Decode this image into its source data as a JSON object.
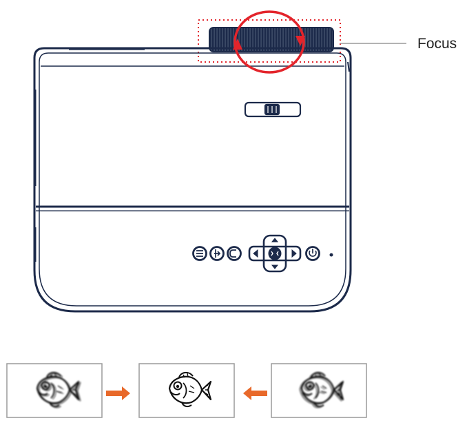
{
  "labels": {
    "focus": "Focus"
  },
  "colors": {
    "outline": "#1c2a4a",
    "focus_ring": "#e3242b",
    "arrow": "#e8692a",
    "frame_border": "#9a9a9a",
    "leader_line": "#9a9a9a"
  },
  "icons": {
    "control_buttons": [
      "menu-icon",
      "input-source-icon",
      "back-icon",
      "left-arrow-icon",
      "ok-icon",
      "right-arrow-icon",
      "power-icon"
    ],
    "focus_sequence": [
      "blurry-fish-icon",
      "arrow-right-icon",
      "sharp-fish-icon",
      "arrow-left-icon",
      "blurry-fish-icon"
    ]
  }
}
